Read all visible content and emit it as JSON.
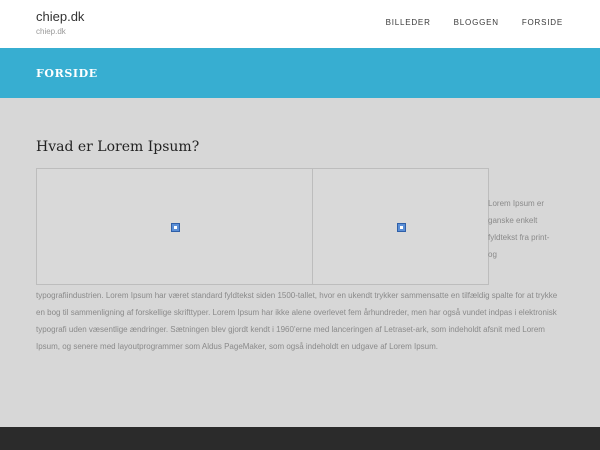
{
  "header": {
    "site_title": "chiep.dk",
    "site_tagline": "chiep.dk",
    "nav": [
      {
        "label": "BILLEDER"
      },
      {
        "label": "BLOGGEN"
      },
      {
        "label": "FORSIDE"
      }
    ]
  },
  "banner": {
    "title": "FORSIDE"
  },
  "post": {
    "title": "Hvad er Lorem Ipsum?",
    "side_text": "Lorem Ipsum er ganske enkelt fyldtekst fra print- og",
    "body_text": "typografiindustrien. Lorem Ipsum har været standard fyldtekst siden 1500-tallet, hvor en ukendt trykker sammensatte en tilfældig spalte for at trykke en bog til sammenligning af forskellige skrifttyper. Lorem Ipsum har ikke alene overlevet fem århundreder, men har også vundet indpas i elektronisk typografi uden væsentlige ændringer. Sætningen blev gjordt kendt i 1960'erne med lanceringen af Letraset-ark, som indeholdt afsnit med Lorem Ipsum, og senere med layoutprogrammer som Aldus PageMaker, som også indeholdt en udgave af Lorem Ipsum."
  },
  "colors": {
    "banner": "#37aed1",
    "background": "#d7d7d7",
    "footer": "#2b2b2b"
  },
  "icons": {
    "image_placeholder": "broken-image-icon"
  }
}
